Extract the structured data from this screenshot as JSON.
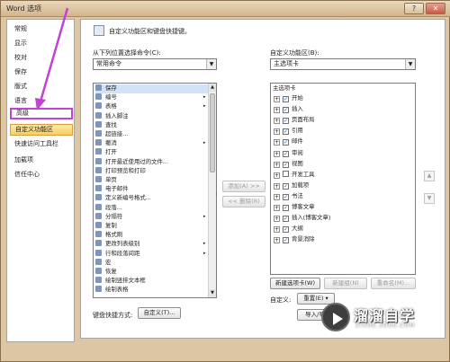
{
  "window": {
    "title": "Word 选项",
    "help": "?",
    "close": "✕"
  },
  "nav": [
    {
      "label": "常规"
    },
    {
      "label": "显示"
    },
    {
      "label": "校对"
    },
    {
      "label": "保存"
    },
    {
      "label": "版式"
    },
    {
      "label": "语言"
    },
    {
      "label": "高级"
    },
    {
      "label": "自定义功能区"
    },
    {
      "label": "快速访问工具栏"
    },
    {
      "label": "加载项"
    },
    {
      "label": "信任中心"
    }
  ],
  "header": {
    "text": "自定义功能区和键盘快捷键。"
  },
  "left": {
    "label": "从下列位置选择命令(C):",
    "selected": "常用命令",
    "commands": [
      {
        "label": "保存"
      },
      {
        "label": "编号",
        "sub": "▸"
      },
      {
        "label": "表格",
        "sub": "▸"
      },
      {
        "label": "插入脚注"
      },
      {
        "label": "查找"
      },
      {
        "label": "超链接..."
      },
      {
        "label": "撤消",
        "sub": "▸"
      },
      {
        "label": "打开"
      },
      {
        "label": "打开最近使用过的文件..."
      },
      {
        "label": "打印预览和打印"
      },
      {
        "label": "单页"
      },
      {
        "label": "电子邮件"
      },
      {
        "label": "定义新编号格式..."
      },
      {
        "label": "段落..."
      },
      {
        "label": "分隔符",
        "sub": "▸"
      },
      {
        "label": "复制"
      },
      {
        "label": "格式刷"
      },
      {
        "label": "更改列表级别",
        "sub": "▸"
      },
      {
        "label": "行和段落间距",
        "sub": "▸"
      },
      {
        "label": "宏"
      },
      {
        "label": "恢复"
      },
      {
        "label": "绘制竖排文本框"
      },
      {
        "label": "绘制表格"
      }
    ]
  },
  "middle": {
    "add": "添加(A) >>",
    "remove": "<< 删除(R)"
  },
  "right": {
    "label": "自定义功能区(B):",
    "selected": "主选项卡",
    "group_title": "主选项卡",
    "tabs": [
      {
        "label": "开始",
        "checked": "✓"
      },
      {
        "label": "插入",
        "checked": "✓"
      },
      {
        "label": "页面布局",
        "checked": "✓"
      },
      {
        "label": "引用",
        "checked": "✓"
      },
      {
        "label": "邮件",
        "checked": "✓"
      },
      {
        "label": "审阅",
        "checked": "✓"
      },
      {
        "label": "视图",
        "checked": "✓"
      },
      {
        "label": "开发工具",
        "checked": ""
      },
      {
        "label": "加载项",
        "checked": "✓"
      },
      {
        "label": "书法",
        "checked": "✓"
      },
      {
        "label": "博客文章",
        "checked": "✓"
      },
      {
        "label": "插入(博客文章)",
        "checked": "✓"
      },
      {
        "label": "大纲",
        "checked": "✓"
      },
      {
        "label": "背景消除",
        "checked": "✓"
      }
    ],
    "new_tab": "新建选项卡(W)",
    "new_group": "新建组(N)",
    "rename": "重命名(M)...",
    "customize_label": "自定义:",
    "reset": "重置(E) ▾",
    "import": "导入/导"
  },
  "keyboard": {
    "label": "键盘快捷方式:",
    "button": "自定义(T)..."
  },
  "watermark": {
    "brand": "溜溜自学",
    "sub": "ZIXUE.3D66.COM"
  },
  "colors": {
    "annotation": "#c043d3",
    "selected_nav": "#f6cf5f"
  }
}
